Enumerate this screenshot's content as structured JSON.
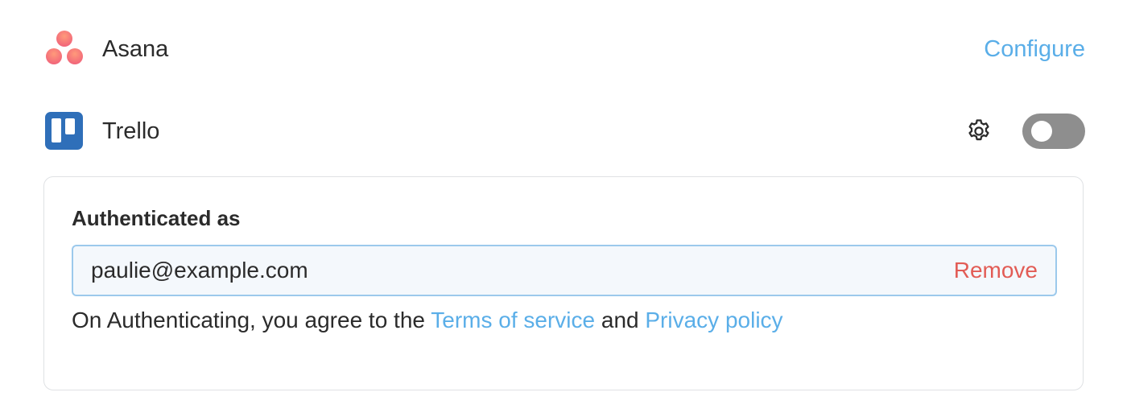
{
  "integrations": [
    {
      "name": "Asana",
      "icon": "asana-logo-icon",
      "action_label": "Configure"
    },
    {
      "name": "Trello",
      "icon": "trello-logo-icon",
      "settings_icon": "gear-icon",
      "toggle_enabled": false
    }
  ],
  "auth": {
    "heading": "Authenticated as",
    "email": "paulie@example.com",
    "remove_label": "Remove",
    "agreement_prefix": "On Authenticating, you agree to the",
    "terms_label": "Terms of service",
    "conjunction": "and",
    "privacy_label": "Privacy policy"
  },
  "colors": {
    "link": "#5aaee8",
    "danger": "#e25c55",
    "toggle_off": "#8e8e8e",
    "trello_blue": "#2f6fb9",
    "asana_coral": "#f06a6a"
  }
}
